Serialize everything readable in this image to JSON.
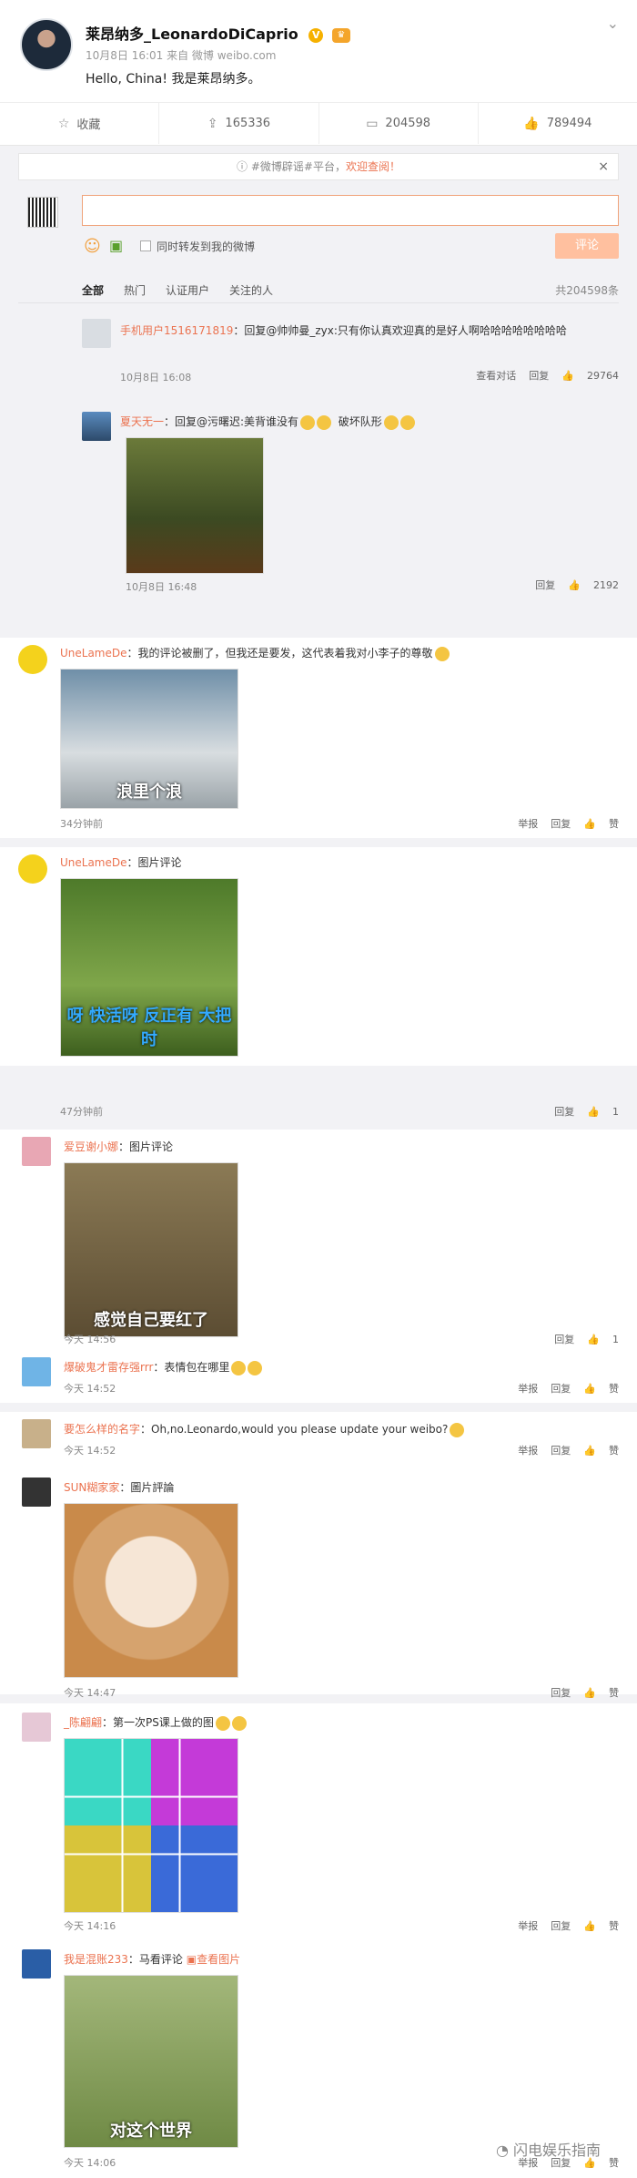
{
  "post": {
    "username": "莱昂纳多_LeonardoDiCaprio",
    "meta": "10月8日 16:01 来自 微博 weibo.com",
    "text": "Hello, China! 我是莱昂纳多。",
    "actions": {
      "favorite": "收藏",
      "repost": "165336",
      "comment": "204598",
      "like": "789494"
    }
  },
  "notice": {
    "text": "#微博辟谣#平台，",
    "highlight": "欢迎查阅！"
  },
  "composer": {
    "sync_label": "同时转发到我的微博",
    "submit_label": "评论"
  },
  "tabs": [
    "全部",
    "热门",
    "认证用户",
    "关注的人"
  ],
  "total": "共204598条",
  "comments": [
    {
      "name": "手机用户1516171819",
      "text": "：回复@帅帅曼_zyx:只有你认真欢迎真的是好人啊哈哈哈哈哈哈哈哈",
      "time": "10月8日 16:08",
      "a1": "查看对话",
      "a2": "回复",
      "likes": "29764"
    },
    {
      "name": "夏天无一",
      "text": "：回复@污曙迟:美背谁没有",
      "extra": "破坏队形",
      "time": "10月8日 16:48",
      "a1": "",
      "a2": "回复",
      "likes": "2192"
    },
    {
      "name": "UneLameDe",
      "text": "：我的评论被删了，但我还是要发，这代表着我对小李子的尊敬",
      "time": "34分钟前",
      "a1": "举报",
      "a2": "回复",
      "likes": "赞",
      "caption": "浪里个浪"
    },
    {
      "name": "UneLameDe",
      "text": "：图片评论",
      "time": "47分钟前",
      "a1": "",
      "a2": "回复",
      "likes": "1",
      "caption": "呀 快活呀 反正有 大把时"
    },
    {
      "name": "爱豆谢小娜",
      "text": "：图片评论",
      "time": "今天 14:56",
      "a1": "",
      "a2": "回复",
      "likes": "1",
      "caption": "感觉自己要红了"
    },
    {
      "name": "爆破鬼才雷存强rrr",
      "text": "：表情包在哪里",
      "time": "今天 14:52",
      "a1": "举报",
      "a2": "回复",
      "likes": "赞"
    },
    {
      "name": "要怎么样的名字",
      "text": "：Oh,no.Leonardo,would you please update your weibo?",
      "time": "今天 14:52",
      "a1": "举报",
      "a2": "回复",
      "likes": "赞"
    },
    {
      "name": "SUN糊家家",
      "text": "：圖片評論",
      "time": "今天 14:47",
      "a1": "",
      "a2": "回复",
      "likes": "赞"
    },
    {
      "name": "_陈翩翩",
      "text": "：第一次PS课上做的图",
      "time": "今天 14:16",
      "a1": "举报",
      "a2": "回复",
      "likes": "赞"
    },
    {
      "name": "我是混账233",
      "text": "：马看评论",
      "link": "查看图片",
      "time": "今天 14:06",
      "a1": "举报",
      "a2": "回复",
      "likes": "赞",
      "caption": "对这个世界"
    }
  ],
  "footer": {
    "brand": "闪电娱乐指南"
  }
}
